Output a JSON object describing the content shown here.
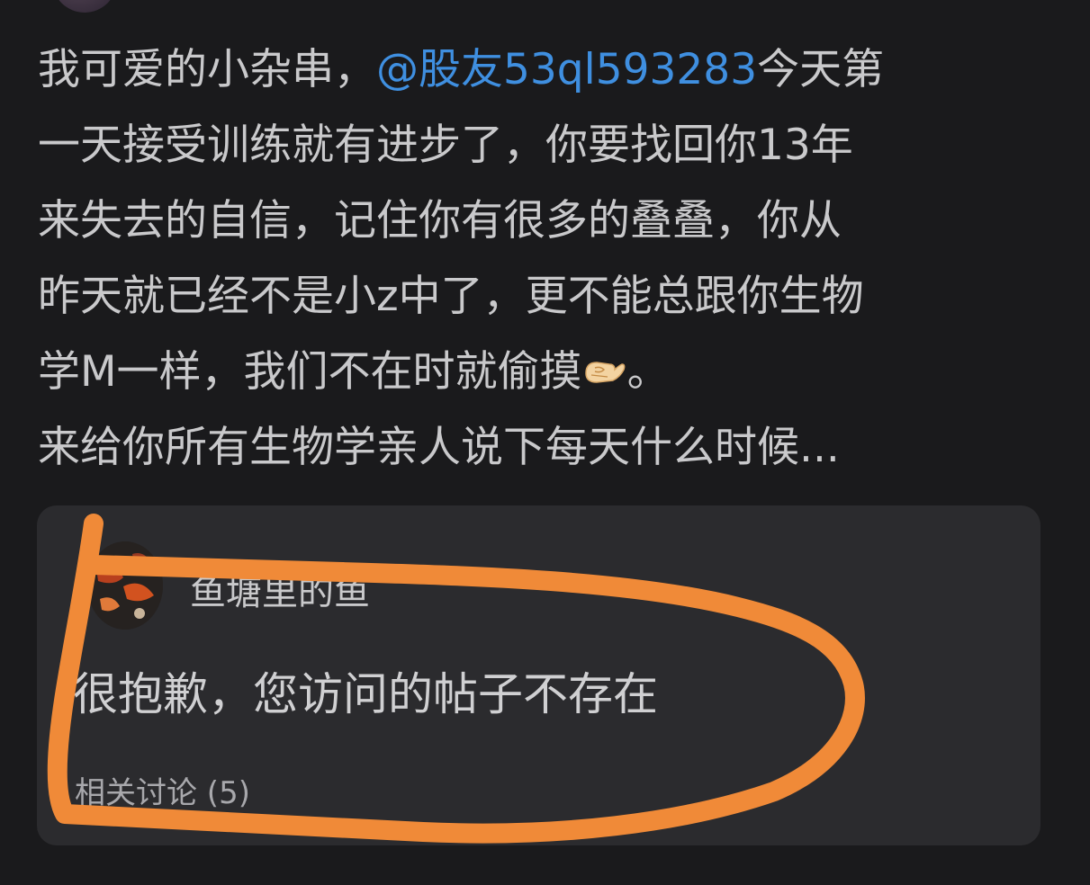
{
  "post": {
    "line1_prefix": "我可爱的小杂串，",
    "mention": "@股友53ql593283",
    "line1_suffix": "今天第",
    "line2": "一天接受训练就有进步了，你要找回你13年",
    "line3": "来失去的自信，记住你有很多的叠叠，你从",
    "line4": "昨天就已经不是小z中了，更不能总跟你生物",
    "line5_prefix": "学M一样，我们不在时就偷摸",
    "line5_emoji": "pinching-hand-emoji",
    "line5_suffix": "。",
    "line6": "来给你所有生物学亲人说下每天什么时候..."
  },
  "quote": {
    "author": "鱼塘里的鱼",
    "message": "很抱歉，您访问的帖子不存在",
    "related": "相关讨论 (5)"
  },
  "colors": {
    "background": "#1a1a1c",
    "text": "#c9c9cb",
    "mention": "#3f8fe0",
    "card": "#2b2b2e",
    "scribble": "#f08a38"
  }
}
